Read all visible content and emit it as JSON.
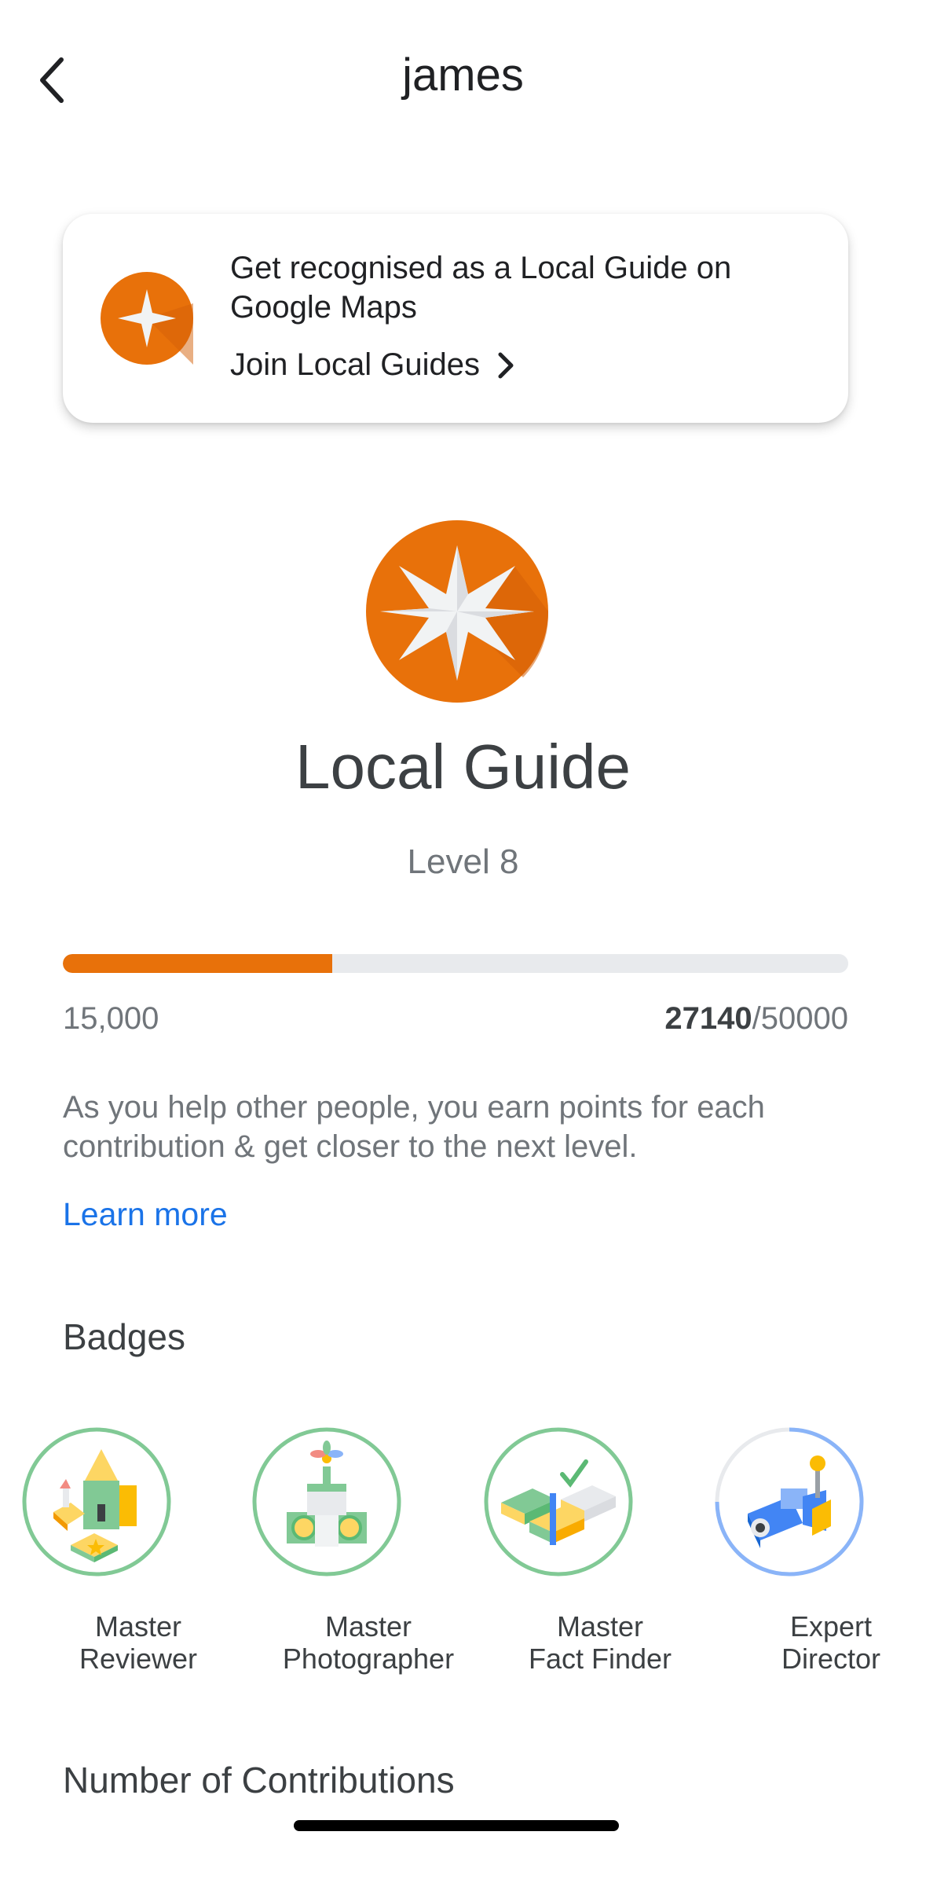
{
  "header": {
    "title": "james"
  },
  "promo": {
    "text": "Get recognised as a Local Guide on Google Maps",
    "link_label": "Join Local Guides"
  },
  "guide": {
    "title": "Local Guide",
    "level": "Level 8"
  },
  "progress": {
    "current_level_points": "15,000",
    "points": "27140",
    "next_level_points": "/50000",
    "fill_fraction": 0.343
  },
  "info": {
    "text": "As you help other people, you earn points for each contribution & get closer to the next level.",
    "learn_more": "Learn more"
  },
  "badges": {
    "title": "Badges",
    "items": [
      {
        "line1": "Master",
        "line2": "Reviewer",
        "icon": "master-reviewer-icon",
        "ring_color": "#81c995"
      },
      {
        "line1": "Master",
        "line2": "Photographer",
        "icon": "master-photographer-icon",
        "ring_color": "#81c995"
      },
      {
        "line1": "Master",
        "line2": "Fact Finder",
        "icon": "master-fact-finder-icon",
        "ring_color": "#81c995"
      },
      {
        "line1": "Expert",
        "line2": "Director",
        "icon": "expert-director-icon",
        "ring_color": "#8ab4f8"
      }
    ]
  },
  "contributions": {
    "title": "Number of Contributions"
  },
  "colors": {
    "accent_orange": "#e8710a",
    "link_blue": "#1a73e8",
    "track_gray": "#e8eaed"
  }
}
